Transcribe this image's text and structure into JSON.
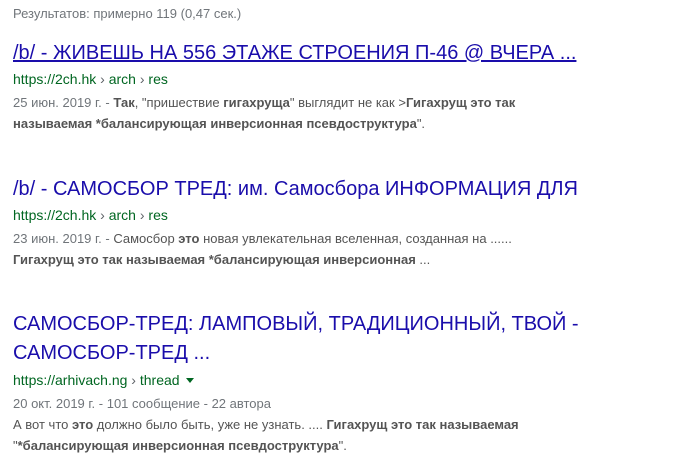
{
  "stats": "Результатов: примерно 119 (0,47 сек.)",
  "results": [
    {
      "title": "/b/ - ЖИВЕШЬ НА 556 ЭТАЖЕ СТРОЕНИЯ П-46 @ ВЧЕРА ...",
      "url_base": "https://2ch.hk",
      "url_path1": "arch",
      "url_path2": "res",
      "date": "25 июн. 2019 г. - ",
      "s1": "Так",
      "s2": ", \"пришествие ",
      "s3": "гигахруща",
      "s4": "\" выглядит не как >",
      "s5": "Гигахрущ это так",
      "s6": "называемая *балансирующая инверсионная псевдоструктура",
      "s7": "\"."
    },
    {
      "title": "/b/ - САМОСБОР ТРЕД: им. Самосбора ИНФОРМАЦИЯ ДЛЯ",
      "url_base": "https://2ch.hk",
      "url_path1": "arch",
      "url_path2": "res",
      "date": "23 июн. 2019 г. - ",
      "s1": "Самосбор ",
      "s2": "это",
      "s3": " новая увлекательная вселенная, созданная на ......",
      "s4": "Гигахрущ это так называемая *балансирующая инверсионная",
      "s5": " ..."
    },
    {
      "title": "САМОСБОР-ТРЕД: ЛАМПОВЫЙ, ТРАДИЦИОННЫЙ, ТВОЙ - САМОСБОР-ТРЕД ...",
      "url_base": "https://arhivach.ng",
      "url_path1": "thread",
      "meta": "20 окт. 2019 г. - 101 сообщение - 22 автора",
      "s1": "А вот что ",
      "s2": "это",
      "s3": " должно было быть, уже не узнать. .... ",
      "s4": "Гигахрущ это так называемая",
      "s5": "\"",
      "s6": "*балансирующая инверсионная псевдоструктура",
      "s7": "\"."
    }
  ],
  "sep_char": "›"
}
